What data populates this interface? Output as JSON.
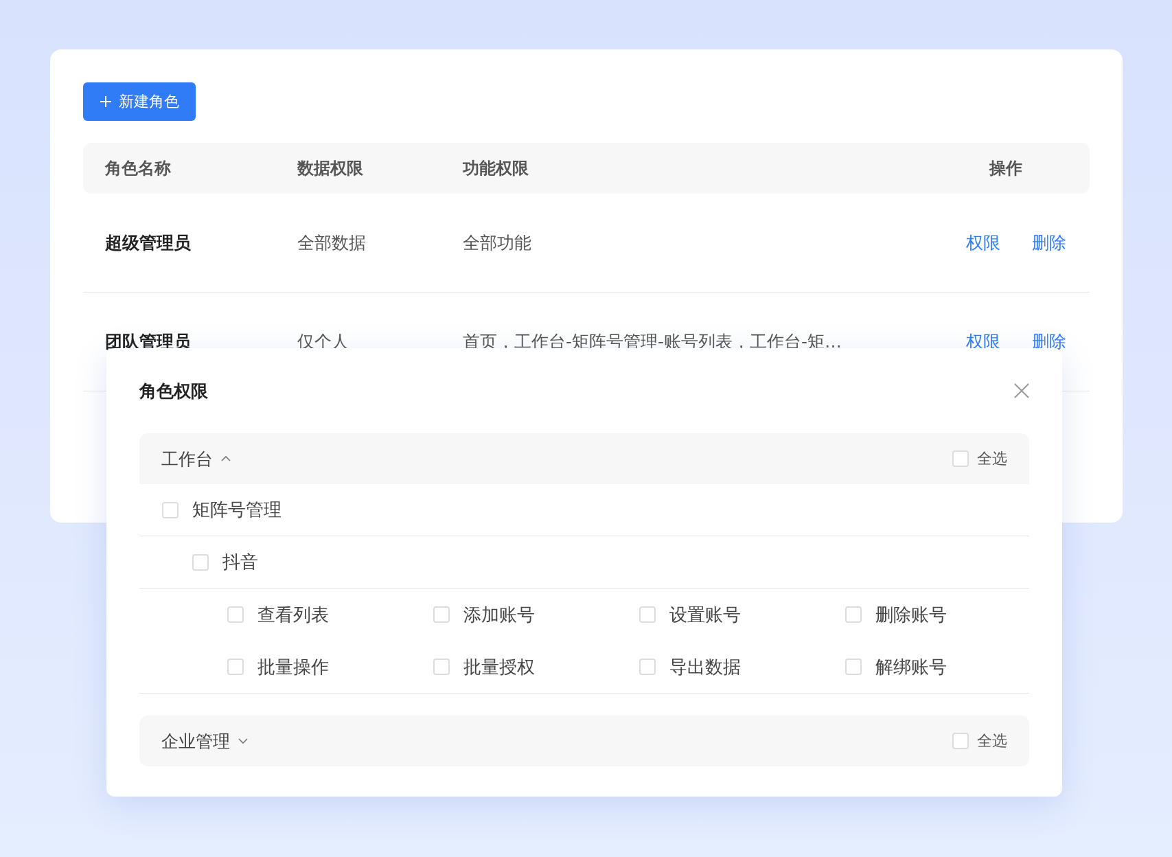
{
  "new_role_button": {
    "label": "新建角色"
  },
  "table": {
    "columns": [
      "角色名称",
      "数据权限",
      "功能权限",
      "操作"
    ],
    "rows": [
      {
        "name": "超级管理员",
        "data_scope": "全部数据",
        "functions": "全部功能",
        "actions": [
          "权限",
          "删除"
        ]
      },
      {
        "name": "团队管理员",
        "data_scope": "仅个人",
        "functions": "首页，工作台-矩阵号管理-账号列表，工作台-矩…",
        "actions": [
          "权限",
          "删除"
        ]
      }
    ]
  },
  "dialog": {
    "title": "角色权限",
    "sections": [
      {
        "label": "工作台",
        "expanded": true,
        "select_all": {
          "label": "全选",
          "checked": false
        },
        "children": [
          {
            "label": "矩阵号管理",
            "checked": false,
            "children": [
              {
                "label": "抖音",
                "checked": false,
                "children": [
                  {
                    "label": "查看列表",
                    "checked": false
                  },
                  {
                    "label": "添加账号",
                    "checked": false
                  },
                  {
                    "label": "设置账号",
                    "checked": false
                  },
                  {
                    "label": "删除账号",
                    "checked": false
                  },
                  {
                    "label": "批量操作",
                    "checked": false
                  },
                  {
                    "label": "批量授权",
                    "checked": false
                  },
                  {
                    "label": "导出数据",
                    "checked": false
                  },
                  {
                    "label": "解绑账号",
                    "checked": false
                  }
                ]
              }
            ]
          }
        ]
      },
      {
        "label": "企业管理",
        "expanded": false,
        "select_all": {
          "label": "全选",
          "checked": false
        }
      }
    ]
  }
}
